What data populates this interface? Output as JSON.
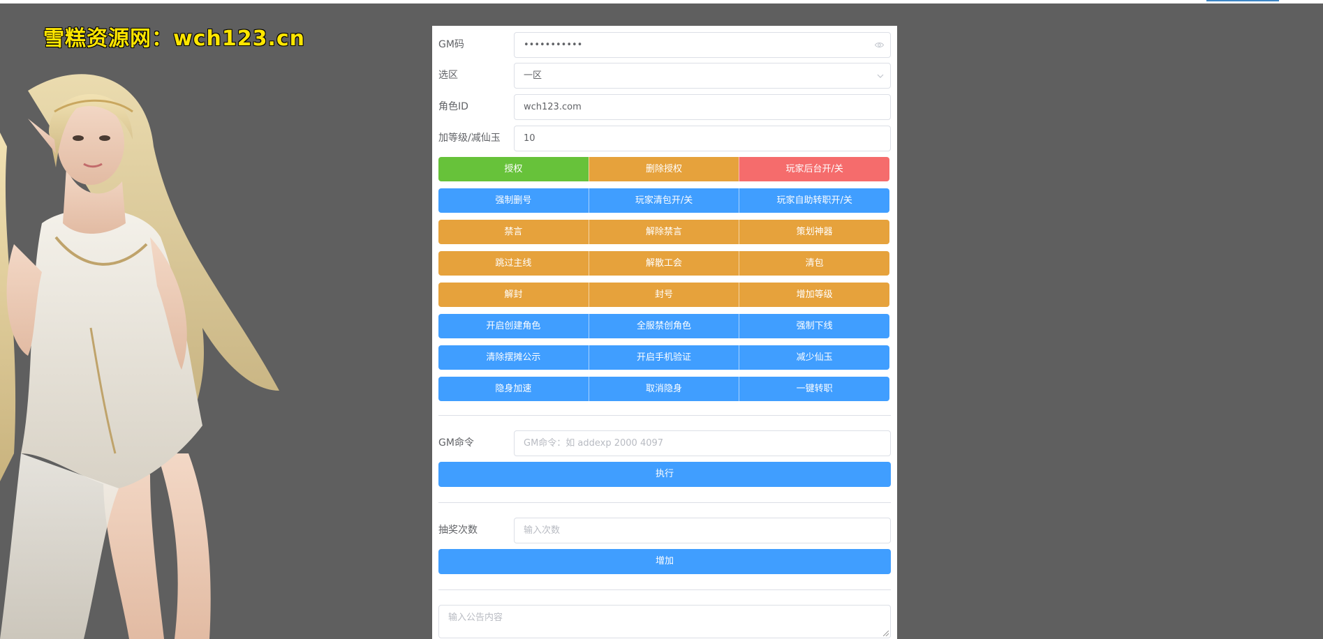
{
  "watermark": "雪糕资源网：wch123.cn",
  "form": {
    "gm_code": {
      "label": "GM码",
      "value": "•••••••••••"
    },
    "zone": {
      "label": "选区",
      "value": "一区"
    },
    "role_id": {
      "label": "角色ID",
      "value": "wch123.com"
    },
    "level": {
      "label": "加等级/减仙玉",
      "value": "10"
    }
  },
  "button_rows": [
    [
      {
        "label": "授权",
        "color": "#67c23a"
      },
      {
        "label": "删除授权",
        "color": "#e6a23c"
      },
      {
        "label": "玩家后台开/关",
        "color": "#f56c6c"
      }
    ],
    [
      {
        "label": "强制删号",
        "color": "#409eff"
      },
      {
        "label": "玩家清包开/关",
        "color": "#409eff"
      },
      {
        "label": "玩家自助转职开/关",
        "color": "#409eff"
      }
    ],
    [
      {
        "label": "禁言",
        "color": "#e6a23c"
      },
      {
        "label": "解除禁言",
        "color": "#e6a23c"
      },
      {
        "label": "策划神器",
        "color": "#e6a23c"
      }
    ],
    [
      {
        "label": "跳过主线",
        "color": "#e6a23c"
      },
      {
        "label": "解散工会",
        "color": "#e6a23c"
      },
      {
        "label": "清包",
        "color": "#e6a23c"
      }
    ],
    [
      {
        "label": "解封",
        "color": "#e6a23c"
      },
      {
        "label": "封号",
        "color": "#e6a23c"
      },
      {
        "label": "增加等级",
        "color": "#e6a23c"
      }
    ],
    [
      {
        "label": "开启创建角色",
        "color": "#409eff"
      },
      {
        "label": "全服禁创角色",
        "color": "#409eff"
      },
      {
        "label": "强制下线",
        "color": "#409eff"
      }
    ],
    [
      {
        "label": "清除摆摊公示",
        "color": "#409eff"
      },
      {
        "label": "开启手机验证",
        "color": "#409eff"
      },
      {
        "label": "减少仙玉",
        "color": "#409eff"
      }
    ],
    [
      {
        "label": "隐身加速",
        "color": "#409eff"
      },
      {
        "label": "取消隐身",
        "color": "#409eff"
      },
      {
        "label": "一键转职",
        "color": "#409eff"
      }
    ]
  ],
  "gm_command": {
    "label": "GM命令",
    "placeholder": "GM命令：如 addexp 2000 4097",
    "button": "执行"
  },
  "lottery": {
    "label": "抽奖次数",
    "placeholder": "输入次数",
    "button": "增加"
  },
  "announcement": {
    "placeholder": "输入公告内容"
  }
}
